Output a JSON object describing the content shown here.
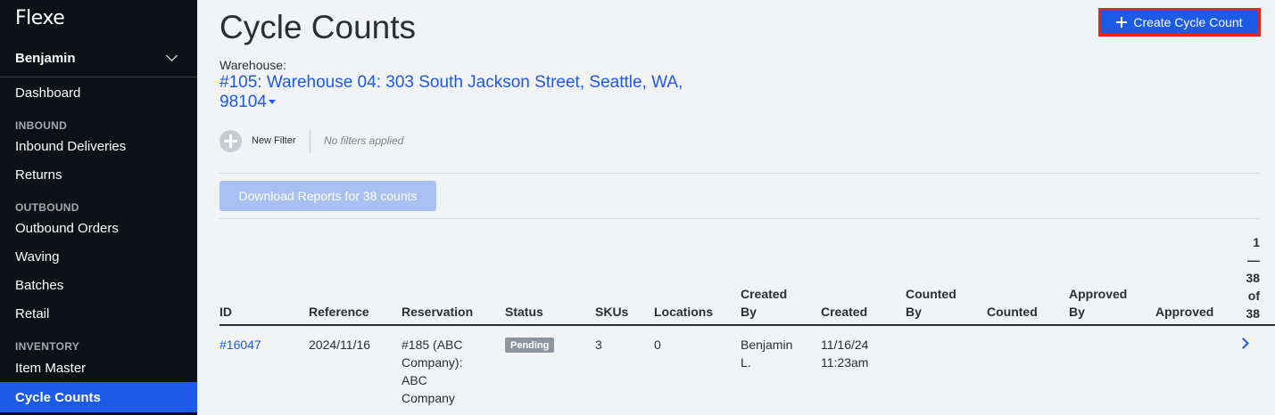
{
  "sidebar": {
    "logo": "Flexe",
    "user": "Benjamin",
    "dashboard": "Dashboard",
    "sections": {
      "inbound": "INBOUND",
      "outbound": "OUTBOUND",
      "inventory": "INVENTORY"
    },
    "items": {
      "inbound_deliveries": "Inbound Deliveries",
      "returns": "Returns",
      "outbound_orders": "Outbound Orders",
      "waving": "Waving",
      "batches": "Batches",
      "retail": "Retail",
      "item_master": "Item Master",
      "cycle_counts": "Cycle Counts"
    }
  },
  "main": {
    "title": "Cycle Counts",
    "create_button": "Create Cycle Count",
    "warehouse_label": "Warehouse:",
    "warehouse_value": "#105: Warehouse 04: 303 South Jackson Street, Seattle, WA, 98104",
    "new_filter": "New Filter",
    "no_filters": "No filters applied",
    "download_button": "Download Reports for 38 counts"
  },
  "table": {
    "pagination": [
      "1",
      "—",
      "38",
      "of",
      "38"
    ],
    "columns": {
      "id": "ID",
      "reference": "Reference",
      "reservation": "Reservation",
      "status": "Status",
      "skus": "SKUs",
      "locations": "Locations",
      "created_by": [
        "Created",
        "By"
      ],
      "created": "Created",
      "counted_by": [
        "Counted",
        "By"
      ],
      "counted": "Counted",
      "approved_by": [
        "Approved",
        "By"
      ],
      "approved": "Approved"
    },
    "rows": [
      {
        "id": "#16047",
        "reference": "2024/11/16",
        "reservation": [
          "#185 (ABC",
          "Company):",
          "ABC",
          "Company"
        ],
        "status": "Pending",
        "skus": "3",
        "locations": "0",
        "created_by": [
          "Benjamin",
          "L."
        ],
        "created": [
          "11/16/24",
          "11:23am"
        ]
      }
    ]
  },
  "colors": {
    "sidebar_bg": "#0d1117",
    "accent": "#1e5ae8",
    "highlight_border": "#e0261c",
    "badge_pending": "#8f959c"
  }
}
